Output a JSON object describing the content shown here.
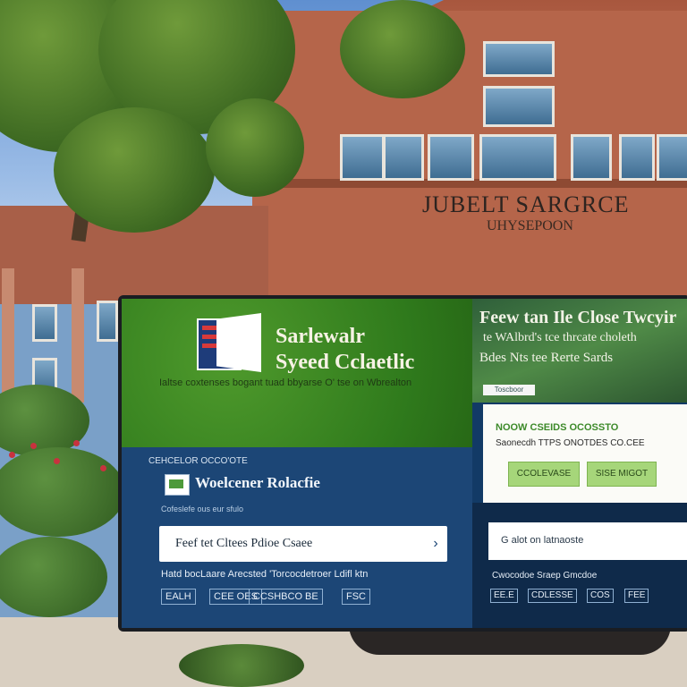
{
  "scene": {
    "building_sign": "JUBELT SARGRCE",
    "building_sign_sub": "UHYSEPOON"
  },
  "brand": {
    "name_line1": "Sarlewalr",
    "name_line2": "Syeed Cclaetlic",
    "tagline": "Ialtse coxtenses bogant tuad bbyarse O' tse on Wbrealton"
  },
  "welcome": {
    "section_title": "CEHCELOR OCCO'OTE",
    "heading": "Woelcener Rolacfie",
    "caption": "Cofeslefe ous eur sfulo"
  },
  "search": {
    "placeholder": "Feef tet Cltees Pdioe Csaee",
    "value": "Feef tet Cltees Pdioe Csaee"
  },
  "info": {
    "line": "Hatd bocLaare Arecsted 'Torcocdetroer Ldifl ktn",
    "tags": [
      "EALH",
      "CEE OES",
      "CCSHBCO BE",
      "FSC"
    ]
  },
  "photo": {
    "headline": "Feew tan Ile Close Twcyir",
    "line2": "te WAlbrd's tce thrcate choleth",
    "line3": "Bdes Nts tee Rerte Sards",
    "chip": "Toscboor"
  },
  "card": {
    "title": "NOOW CSEIDS OCOSSTO",
    "subtitle": "Saonecdh TTPS ONOTDES CO.CEE",
    "button_left": "CCOLEVASE",
    "button_right": "SISE MIGOT"
  },
  "right": {
    "search_text": "G alot on latnaoste",
    "line": "Cwocodoe Sraep Gmcdoe",
    "tags": [
      "EE.E",
      "CDLESSE",
      "COS",
      "FEE"
    ]
  },
  "colors": {
    "green_panel": "#2f7a1c",
    "blue_panel": "#1c4676",
    "navy_panel": "#0f2a4a",
    "accent_button": "#a6d67a",
    "building": "#b5654a"
  }
}
